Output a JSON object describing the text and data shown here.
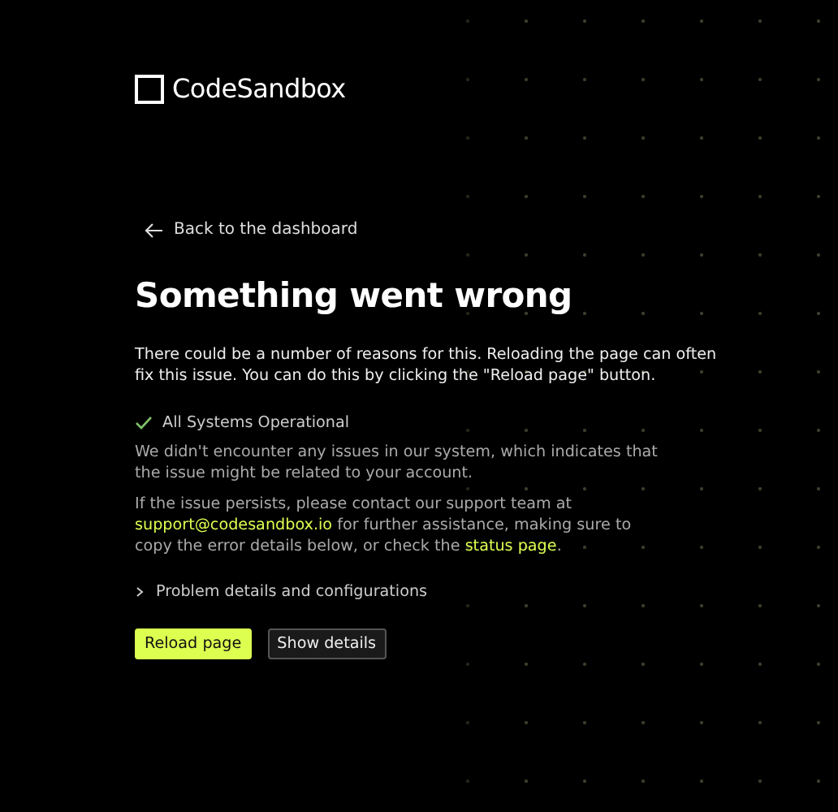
{
  "logo": {
    "text": "CodeSandbox"
  },
  "back_link": {
    "label": "Back to the dashboard"
  },
  "heading": "Something went wrong",
  "intro": "There could be a number of reasons for this. Reloading the page can often fix this issue. You can do this by clicking the \"Reload page\" button.",
  "status": {
    "label": "All Systems Operational",
    "ok": true
  },
  "explanation": "We didn't encounter any issues in our system, which indicates that the issue might be related to your account.",
  "support": [
    {
      "kind": "text",
      "text": "If the issue persists, please contact our support team at "
    },
    {
      "kind": "link",
      "text": "support@codesandbox.io"
    },
    {
      "kind": "text",
      "text": " for further assistance, making sure to copy the error details below, or check the "
    },
    {
      "kind": "link",
      "text": "status page"
    },
    {
      "kind": "text",
      "text": "."
    }
  ],
  "details": {
    "label": "Problem details and configurations",
    "expanded": false
  },
  "buttons": [
    {
      "label": "Reload page",
      "kind": "primary"
    },
    {
      "label": "Show details",
      "kind": "secondary"
    }
  ]
}
